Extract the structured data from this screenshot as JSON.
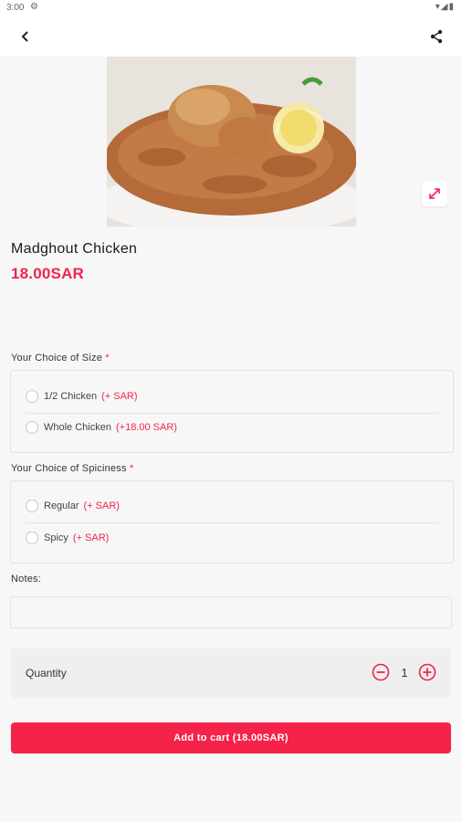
{
  "status_bar": {
    "time": "3:00",
    "settings_icon": "gear-icon",
    "right_icons": "wifi-icon battery-icon"
  },
  "toolbar": {
    "back_icon": "arrow-left-icon",
    "share_icon": "share-icon"
  },
  "hero": {
    "image": "chicken-rice-dish"
  },
  "product": {
    "title": "Madghout Chicken",
    "price": "18.00SAR"
  },
  "size": {
    "label": "Your Choice of Size",
    "required_mark": "*",
    "options": [
      {
        "label": "1/2 Chicken",
        "price": "(+ SAR)"
      },
      {
        "label": "Whole Chicken",
        "price": "(+18.00 SAR)"
      }
    ]
  },
  "spiciness": {
    "label": "Your Choice of Spiciness",
    "required_mark": "*",
    "options": [
      {
        "label": "Regular",
        "price": "(+ SAR)"
      },
      {
        "label": "Spicy",
        "price": "(+ SAR)"
      }
    ]
  },
  "notes": {
    "label": "Notes:",
    "value": ""
  },
  "quantity": {
    "label": "Quantity",
    "value": "1"
  },
  "cart": {
    "label": "Add to cart (18.00SAR)"
  },
  "colors": {
    "accent": "#f5234a",
    "background": "#f7f7f7"
  }
}
